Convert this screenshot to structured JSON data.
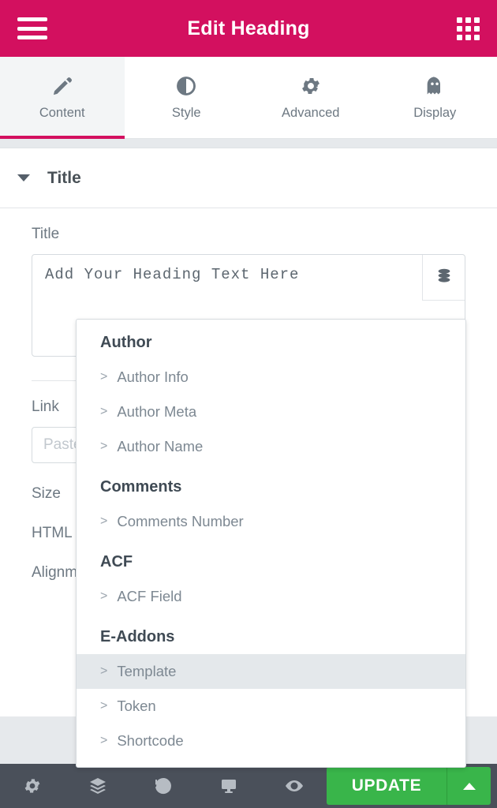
{
  "colors": {
    "header_pink": "#d3105f",
    "accent_pink": "#d3105f",
    "update_green": "#39b54a",
    "footer_dark": "#4a505a",
    "text_gray": "#6d7882"
  },
  "header": {
    "title": "Edit Heading",
    "menu_icon": "hamburger-icon",
    "apps_icon": "grid-apps-icon"
  },
  "tabs": [
    {
      "label": "Content",
      "icon": "pencil-icon",
      "active": true
    },
    {
      "label": "Style",
      "icon": "contrast-icon",
      "active": false
    },
    {
      "label": "Advanced",
      "icon": "gear-icon",
      "active": false
    },
    {
      "label": "Display",
      "icon": "ghost-icon",
      "active": false
    }
  ],
  "section": {
    "title": "Title",
    "collapse_icon": "caret-down-icon"
  },
  "controls": {
    "title_label": "Title",
    "title_value": "Add Your Heading Text Here",
    "dynamic_tag_icon": "database-stack-icon",
    "link_label": "Link",
    "link_placeholder": "Paste URL or type",
    "size_label": "Size",
    "html_tag_label": "HTML Tag",
    "alignment_label": "Alignment"
  },
  "dropdown": {
    "groups": [
      {
        "title": "Author",
        "items": [
          {
            "label": "Author Info",
            "highlight": false
          },
          {
            "label": "Author Meta",
            "highlight": false
          },
          {
            "label": "Author Name",
            "highlight": false
          }
        ]
      },
      {
        "title": "Comments",
        "items": [
          {
            "label": "Comments Number",
            "highlight": false
          }
        ]
      },
      {
        "title": "ACF",
        "items": [
          {
            "label": "ACF Field",
            "highlight": false
          }
        ]
      },
      {
        "title": "E-Addons",
        "items": [
          {
            "label": "Template",
            "highlight": true
          },
          {
            "label": "Token",
            "highlight": false
          },
          {
            "label": "Shortcode",
            "highlight": false
          }
        ]
      }
    ],
    "item_prefix": ">"
  },
  "footer": {
    "icons": [
      {
        "name": "settings-gear-icon"
      },
      {
        "name": "layers-navigator-icon"
      },
      {
        "name": "history-icon"
      },
      {
        "name": "responsive-monitor-icon"
      },
      {
        "name": "preview-eye-icon"
      }
    ],
    "update_label": "UPDATE",
    "update_caret_icon": "caret-up-icon"
  }
}
